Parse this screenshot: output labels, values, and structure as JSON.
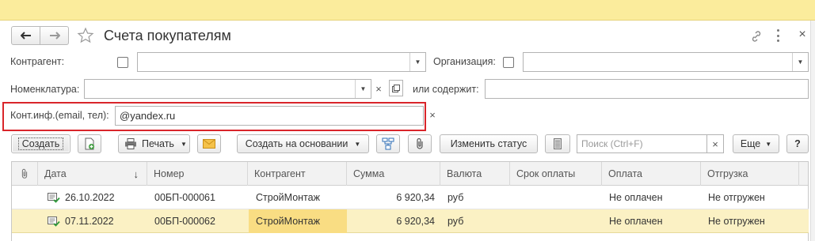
{
  "window": {
    "title": "Счета покупателям"
  },
  "filters": {
    "counterparty_label": "Контрагент:",
    "organization_label": "Организация:",
    "nomenclature_label": "Номенклатура:",
    "or_contains_label": "или содержит:",
    "contact_label": "Конт.инф.(email, тел):",
    "contact_value": "@yandex.ru"
  },
  "toolbar": {
    "create_label": "Создать",
    "print_label": "Печать",
    "create_based_label": "Создать на основании",
    "change_status_label": "Изменить статус",
    "search_placeholder": "Поиск (Ctrl+F)",
    "more_label": "Еще",
    "help_label": "?"
  },
  "table": {
    "columns": [
      "Дата",
      "Номер",
      "Контрагент",
      "Сумма",
      "Валюта",
      "Срок оплаты",
      "Оплата",
      "Отгрузка"
    ],
    "rows": [
      {
        "date": "26.10.2022",
        "number": "00БП-000061",
        "counterparty": "СтройМонтаж",
        "sum": "6 920,34",
        "currency": "руб",
        "due": "",
        "payment": "Не оплачен",
        "shipment": "Не отгружен"
      },
      {
        "date": "07.11.2022",
        "number": "00БП-000062",
        "counterparty": "СтройМонтаж",
        "sum": "6 920,34",
        "currency": "руб",
        "due": "",
        "payment": "Не оплачен",
        "shipment": "Не отгружен"
      }
    ]
  },
  "colors": {
    "highlight_border": "#d9252a",
    "selected_row": "#fbf1c4",
    "selected_cell": "#f9dd83",
    "status_bar": "#fbec9c"
  }
}
